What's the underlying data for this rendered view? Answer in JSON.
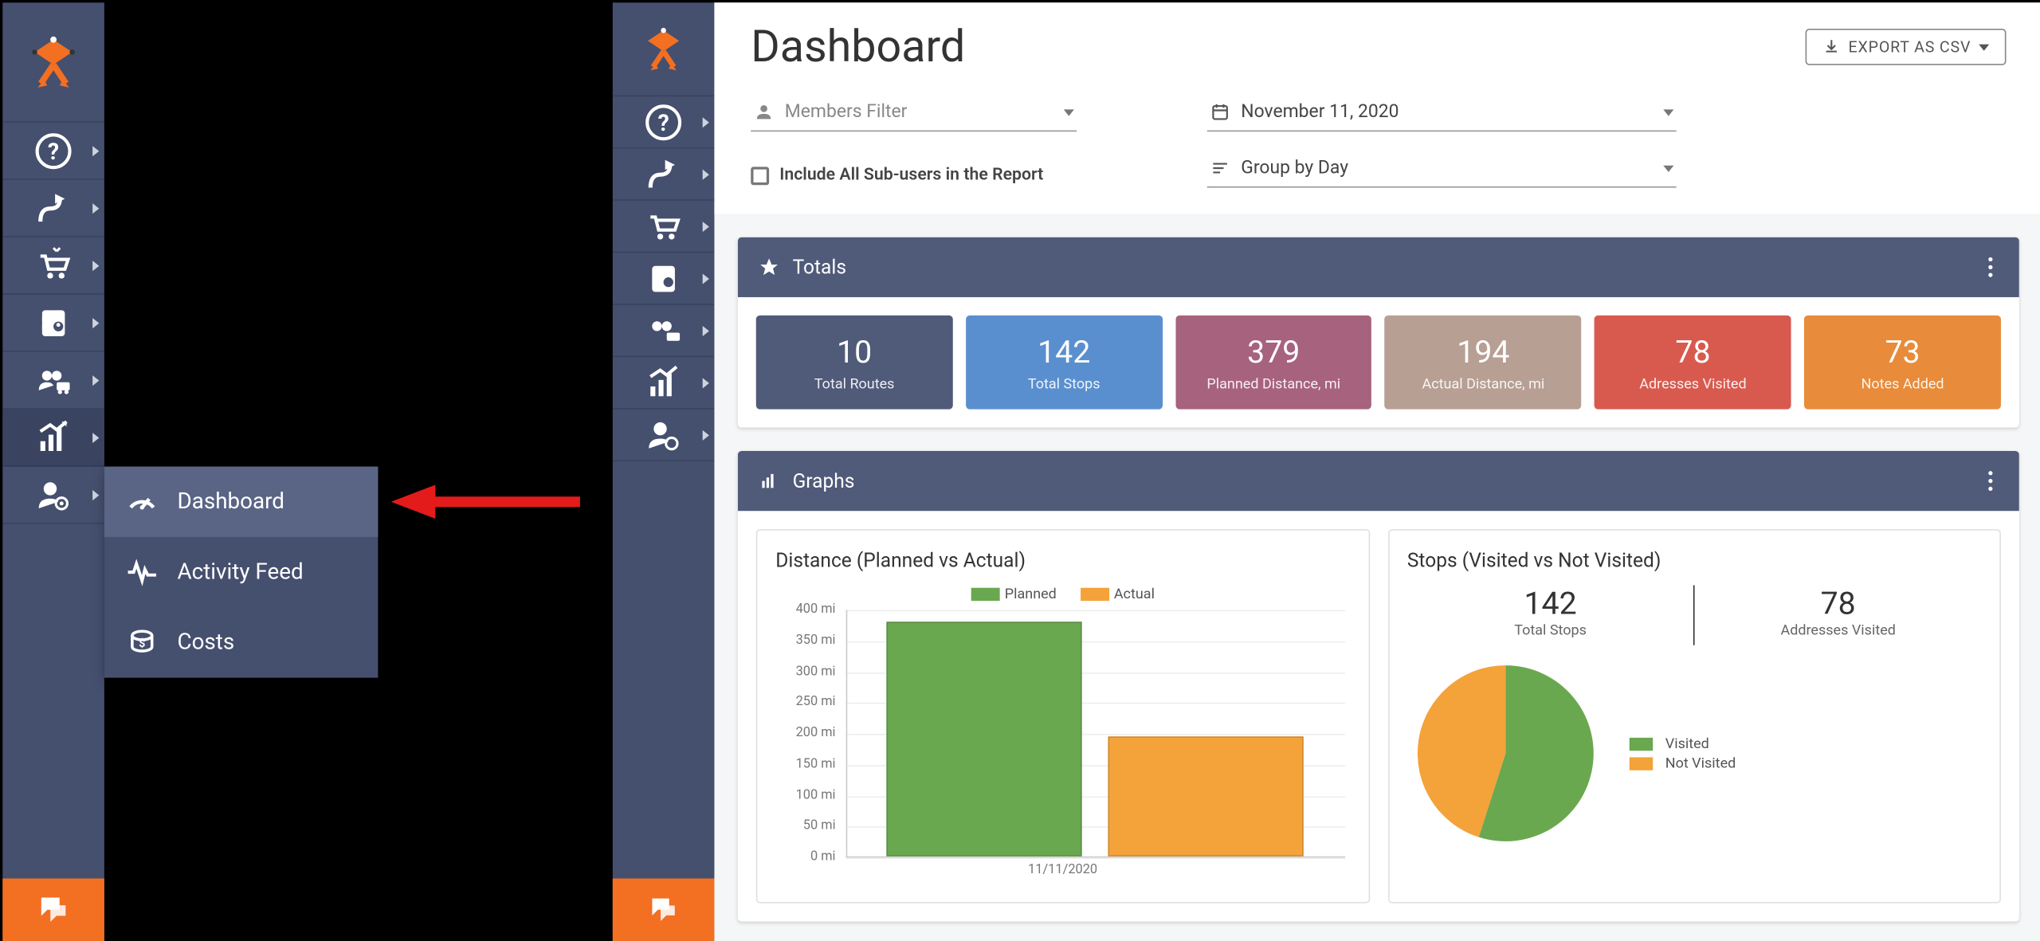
{
  "page": {
    "title": "Dashboard",
    "export_label": "EXPORT AS CSV"
  },
  "filters": {
    "members_placeholder": "Members Filter",
    "date_value": "November 11, 2020",
    "group_value": "Group by Day",
    "include_sub_label": "Include All Sub-users in the Report"
  },
  "submenu": {
    "items": [
      {
        "label": "Dashboard"
      },
      {
        "label": "Activity Feed"
      },
      {
        "label": "Costs"
      }
    ]
  },
  "totals": {
    "header": "Totals",
    "cards": [
      {
        "value": "10",
        "label": "Total Routes",
        "color": "#505a79"
      },
      {
        "value": "142",
        "label": "Total Stops",
        "color": "#5a8fcf"
      },
      {
        "value": "379",
        "label": "Planned Distance, mi",
        "color": "#a7627e"
      },
      {
        "value": "194",
        "label": "Actual Distance, mi",
        "color": "#b79f94"
      },
      {
        "value": "78",
        "label": "Adresses Visited",
        "color": "#d85a4f"
      },
      {
        "value": "73",
        "label": "Notes Added",
        "color": "#e88b3a"
      }
    ]
  },
  "graphs": {
    "header": "Graphs",
    "distance": {
      "title": "Distance (Planned vs Actual)",
      "legend_planned": "Planned",
      "legend_actual": "Actual",
      "xcategory": "11/11/2020"
    },
    "stops": {
      "title": "Stops (Visited vs Not Visited)",
      "total_stops_value": "142",
      "total_stops_label": "Total Stops",
      "visited_value": "78",
      "visited_label": "Addresses Visited",
      "legend_visited": "Visited",
      "legend_not_visited": "Not Visited"
    }
  },
  "chart_data": [
    {
      "type": "bar",
      "title": "Distance (Planned vs Actual)",
      "categories": [
        "11/11/2020"
      ],
      "series": [
        {
          "name": "Planned",
          "values": [
            379
          ],
          "color": "#6aa84f"
        },
        {
          "name": "Actual",
          "values": [
            194
          ],
          "color": "#f4a23a"
        }
      ],
      "ylabel": "mi",
      "ylim": [
        0,
        400
      ],
      "yticks": [
        0,
        50,
        100,
        150,
        200,
        250,
        300,
        350,
        400
      ]
    },
    {
      "type": "pie",
      "title": "Stops (Visited vs Not Visited)",
      "series": [
        {
          "name": "Visited",
          "value": 78,
          "color": "#6aa84f"
        },
        {
          "name": "Not Visited",
          "value": 64,
          "color": "#f4a23a"
        }
      ],
      "total": 142
    }
  ]
}
